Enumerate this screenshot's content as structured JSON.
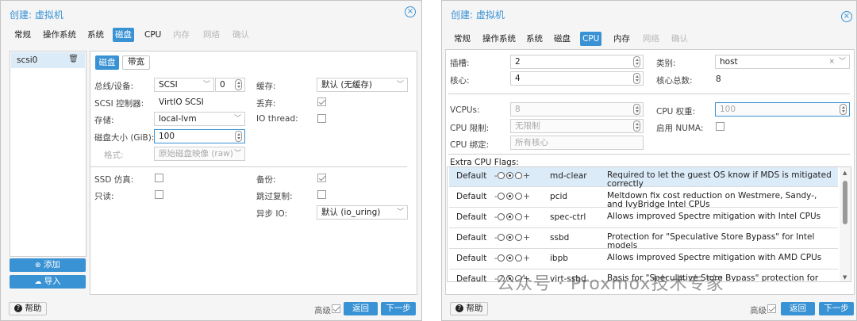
{
  "w1": {
    "title": "创建: 虚拟机",
    "tabs": [
      "常规",
      "操作系统",
      "系统",
      "磁盘",
      "CPU",
      "内存",
      "网络",
      "确认"
    ],
    "disk_list": {
      "item": "scsi0",
      "add_button": "添加",
      "import_button": "导入"
    },
    "subtabs": {
      "disk": "磁盘",
      "bandwidth": "带宽"
    },
    "form": {
      "bus_label": "总线/设备:",
      "bus_value": "SCSI",
      "bus_index": "0",
      "scsi_ctrl_label": "SCSI 控制器:",
      "scsi_ctrl_value": "VirtIO SCSI",
      "storage_label": "存储:",
      "storage_value": "local-lvm",
      "size_label": "磁盘大小 (GiB):",
      "size_value": "100",
      "format_label": "格式:",
      "format_value": "原始磁盘映像 (raw)",
      "cache_label": "缓存:",
      "cache_value": "默认 (无缓存)",
      "discard_label": "丢弃:",
      "iothread_label": "IO thread:",
      "ssd_label": "SSD 仿真:",
      "readonly_label": "只读:",
      "backup_label": "备份:",
      "skip_repl_label": "跳过复制:",
      "async_label": "异步 IO:",
      "async_value": "默认 (io_uring)"
    },
    "checks": {
      "discard": true,
      "iothread": false,
      "ssd": false,
      "readonly": false,
      "backup": true,
      "skip_repl": false
    },
    "footer": {
      "help": "帮助",
      "advanced": "高级",
      "advanced_checked": true,
      "back": "返回",
      "next": "下一步"
    }
  },
  "w2": {
    "title": "创建: 虚拟机",
    "tabs": [
      "常规",
      "操作系统",
      "系统",
      "磁盘",
      "CPU",
      "内存",
      "网络",
      "确认"
    ],
    "form": {
      "sockets_label": "插槽:",
      "sockets_value": "2",
      "cores_label": "核心:",
      "cores_value": "4",
      "type_label": "类别:",
      "type_value": "host",
      "total_cores_label": "核心总数:",
      "total_cores_value": "8",
      "vcpus_label": "VCPUs:",
      "vcpus_value": "8",
      "cpu_limit_label": "CPU 限制:",
      "cpu_limit_value": "无限制",
      "cpu_affinity_label": "CPU 绑定:",
      "cpu_affinity_value": "所有核心",
      "cpu_weight_label": "CPU 权重:",
      "cpu_weight_value": "100",
      "numa_label": "启用 NUMA:",
      "flags_title": "Extra CPU Flags:"
    },
    "flags": [
      {
        "state": "Default",
        "name": "md-clear",
        "desc": "Required to let the guest OS know if MDS is mitigated correctly"
      },
      {
        "state": "Default",
        "name": "pcid",
        "desc": "Meltdown fix cost reduction on Westmere, Sandy-, and IvyBridge Intel CPUs"
      },
      {
        "state": "Default",
        "name": "spec-ctrl",
        "desc": "Allows improved Spectre mitigation with Intel CPUs"
      },
      {
        "state": "Default",
        "name": "ssbd",
        "desc": "Protection for \"Speculative Store Bypass\" for Intel models"
      },
      {
        "state": "Default",
        "name": "ibpb",
        "desc": "Allows improved Spectre mitigation with AMD CPUs"
      },
      {
        "state": "Default",
        "name": "virt-ssbd",
        "desc": "Basis for \"Speculative Store Bypass\" protection for AMD models"
      }
    ],
    "toggle_minus": "-",
    "toggle_plus": "+",
    "footer": {
      "help": "帮助",
      "advanced": "高级",
      "advanced_checked": true,
      "back": "返回",
      "next": "下一步"
    }
  },
  "watermark": "公众号 · Proxmox技术专家",
  "colors": {
    "accent": "#3892d4",
    "selected_row": "#dcebf8"
  }
}
